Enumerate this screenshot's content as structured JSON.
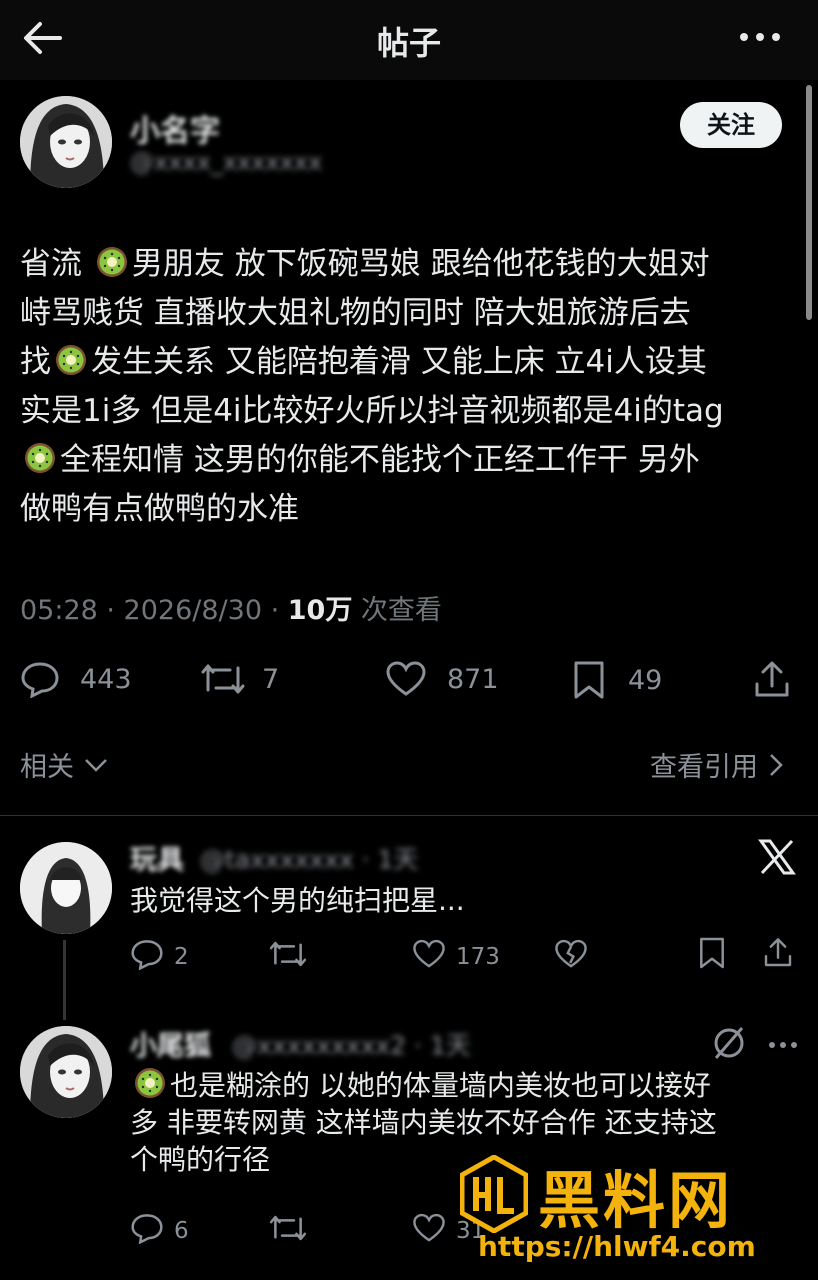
{
  "header": {
    "title": "帖子",
    "back_icon": "arrow-left-icon",
    "more_icon": "more-dots-icon"
  },
  "post": {
    "author_name": "小名字",
    "author_handle": "@xxxx_xxxxxxx",
    "follow_label": "关注",
    "lines": [
      [
        "省流 ",
        "kiwi",
        "男朋友 放下饭碗骂娘 跟给他花钱的大姐对"
      ],
      [
        "峙骂贱货 直播收大姐礼物的同时 陪大姐旅游后去"
      ],
      [
        "找",
        "kiwi",
        "发生关系 又能陪抱着滑 又能上床 立4i人设其"
      ],
      [
        "实是1i多 但是4i比较好火所以抖音视频都是4i的tag"
      ],
      [
        "kiwi",
        "全程知情 这男的你能不能找个正经工作干 另外"
      ],
      [
        "做鸭有点做鸭的水准"
      ]
    ],
    "time": "05:28 · 2026/8/30 · ",
    "views": "10万",
    "views_suffix": " 次查看",
    "stats": {
      "replies": "443",
      "reposts": "7",
      "likes": "871",
      "bookmarks": "49"
    },
    "related_label": "相关",
    "quotes_label": "查看引用"
  },
  "replies": [
    {
      "name": "玩具",
      "handle": "@taxxxxxxx · 1天",
      "text": "我觉得这个男的纯扫把星...",
      "stats": {
        "replies": "2",
        "likes": "173"
      }
    },
    {
      "name": "小尾狐",
      "handle": "@xxxxxxxxx2 · 1天",
      "text_lines": [
        [
          "kiwi",
          "也是糊涂的 以她的体量墙内美妆也可以接好"
        ],
        [
          "多 非要转网黄 这样墙内美妆不好合作 还支持这"
        ],
        [
          "个鸭的行径"
        ]
      ],
      "stats": {
        "replies": "6",
        "likes": "31"
      }
    }
  ],
  "watermark": {
    "brand": "黑料网",
    "url": "https://hlwf4.com"
  },
  "colors": {
    "background": "#000000",
    "text": "#e7e9ea",
    "muted": "#71767b",
    "watermark": "#f3b30c"
  }
}
